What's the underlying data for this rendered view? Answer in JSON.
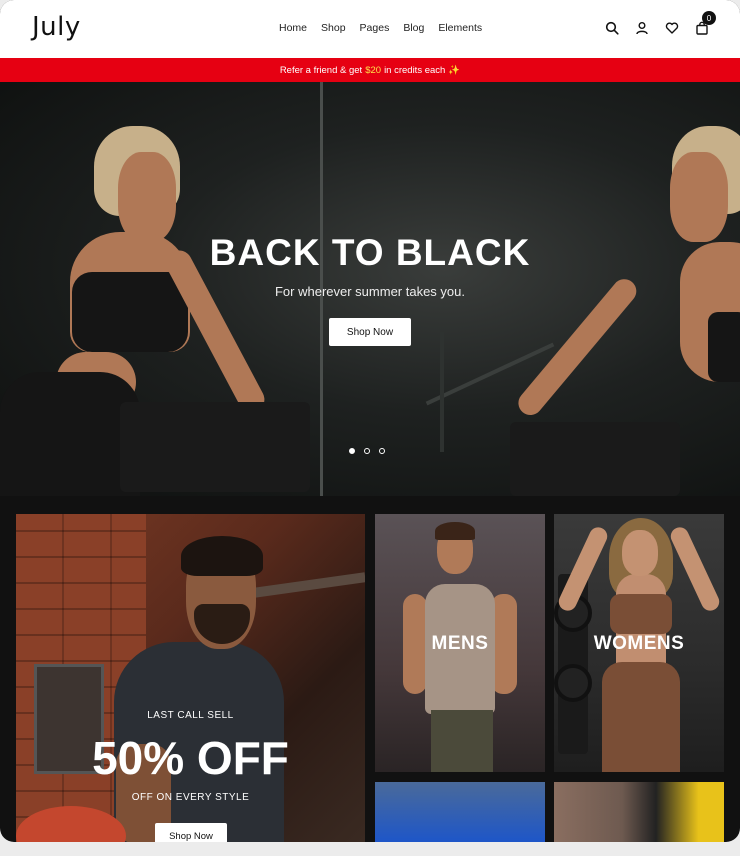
{
  "header": {
    "logo": "July",
    "nav": [
      "Home",
      "Shop",
      "Pages",
      "Blog",
      "Elements"
    ],
    "cart_count": "0"
  },
  "promo": {
    "prefix": "Refer a friend & get",
    "amount": "$20",
    "suffix": "in credits each",
    "emoji": "✨"
  },
  "hero": {
    "title": "BACK TO BLACK",
    "subtitle": "For wherever summer takes you.",
    "button": "Shop Now",
    "slides": 3,
    "active_slide": 1
  },
  "promo_tile": {
    "eyebrow": "LAST CALL SELL",
    "headline": "50% OFF",
    "subline": "OFF ON EVERY STYLE",
    "button": "Shop Now"
  },
  "categories": {
    "mens": "MENS",
    "womens": "WOMENS"
  },
  "colors": {
    "promo_bar": "#e60012",
    "promo_amount": "#ffe14a",
    "page_bg": "#111111"
  },
  "icons": [
    "search-icon",
    "user-icon",
    "heart-icon",
    "cart-icon"
  ]
}
